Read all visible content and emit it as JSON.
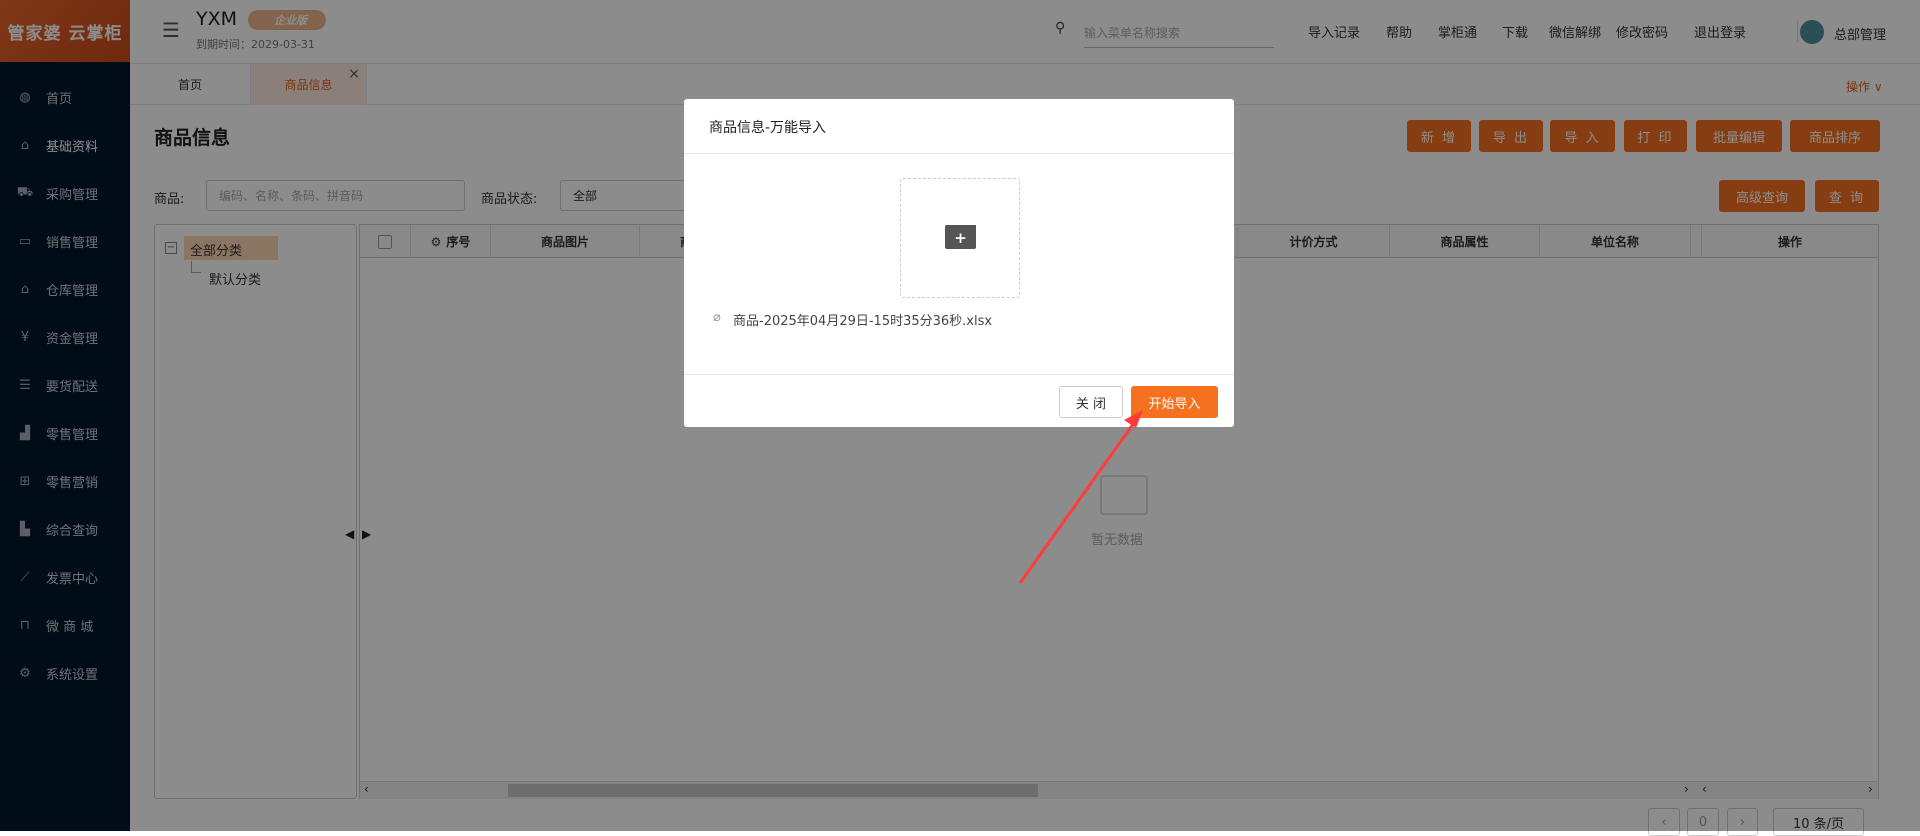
{
  "app": {
    "logo": "管家婆 云掌柜",
    "company": "YXM",
    "edition": "企业版",
    "expiry": "到期时间：2029-03-31"
  },
  "sidebar": {
    "items": [
      {
        "label": "首页",
        "icon": "globe-icon",
        "glyph": "◍"
      },
      {
        "label": "基础资料",
        "icon": "home-icon",
        "glyph": "⌂"
      },
      {
        "label": "采购管理",
        "icon": "cart-icon",
        "glyph": "⛟"
      },
      {
        "label": "销售管理",
        "icon": "sales-icon",
        "glyph": "▭"
      },
      {
        "label": "仓库管理",
        "icon": "bank-icon",
        "glyph": "⌂"
      },
      {
        "label": "资金管理",
        "icon": "wallet-icon",
        "glyph": "¥"
      },
      {
        "label": "要货配送",
        "icon": "list-icon",
        "glyph": "☰"
      },
      {
        "label": "零售管理",
        "icon": "area-chart-icon",
        "glyph": "▟"
      },
      {
        "label": "零售营销",
        "icon": "gift-icon",
        "glyph": "⊞"
      },
      {
        "label": "综合查询",
        "icon": "bar-chart-icon",
        "glyph": "▙"
      },
      {
        "label": "发票中心",
        "icon": "line-chart-icon",
        "glyph": "⟋"
      },
      {
        "label": "微 商 城",
        "icon": "bag-icon",
        "glyph": "⊓"
      },
      {
        "label": "系统设置",
        "icon": "gear-icon",
        "glyph": "⚙"
      }
    ]
  },
  "header": {
    "search_placeholder": "输入菜单名称搜索",
    "links": [
      "导入记录",
      "帮助",
      "掌柜通",
      "下载",
      "微信解绑",
      "修改密码",
      "退出登录"
    ],
    "user": "总部管理"
  },
  "tabs": {
    "items": [
      "首页",
      "商品信息"
    ],
    "close": "×",
    "ops": "操作 ∨"
  },
  "page": {
    "title": "商品信息",
    "buttons": [
      "新 增",
      "导 出",
      "导 入",
      "打 印",
      "批量编辑",
      "商品排序"
    ],
    "filter": {
      "goods_label": "商品:",
      "goods_placeholder": "编码、名称、条码、拼音码",
      "status_label": "商品状态:",
      "status_value": "全部",
      "advanced": "高级查询",
      "query": "查 询"
    }
  },
  "tree": {
    "root": "全部分类",
    "children": [
      "默认分类"
    ]
  },
  "table": {
    "columns": [
      "序号",
      "商品图片",
      "商",
      "计价方式",
      "商品属性",
      "单位名称",
      "操作"
    ],
    "empty": "暂无数据"
  },
  "pagination": {
    "prev": "‹",
    "page": "0",
    "next": "›",
    "size": "10 条/页"
  },
  "modal": {
    "title": "商品信息-万能导入",
    "file": "商品-2025年04月29日-15时35分36秒.xlsx",
    "close": "关 闭",
    "start": "开始导入"
  },
  "colors": {
    "accent": "#f5701f",
    "sidebar": "#00182f",
    "annotation": "#ff3b3b"
  }
}
